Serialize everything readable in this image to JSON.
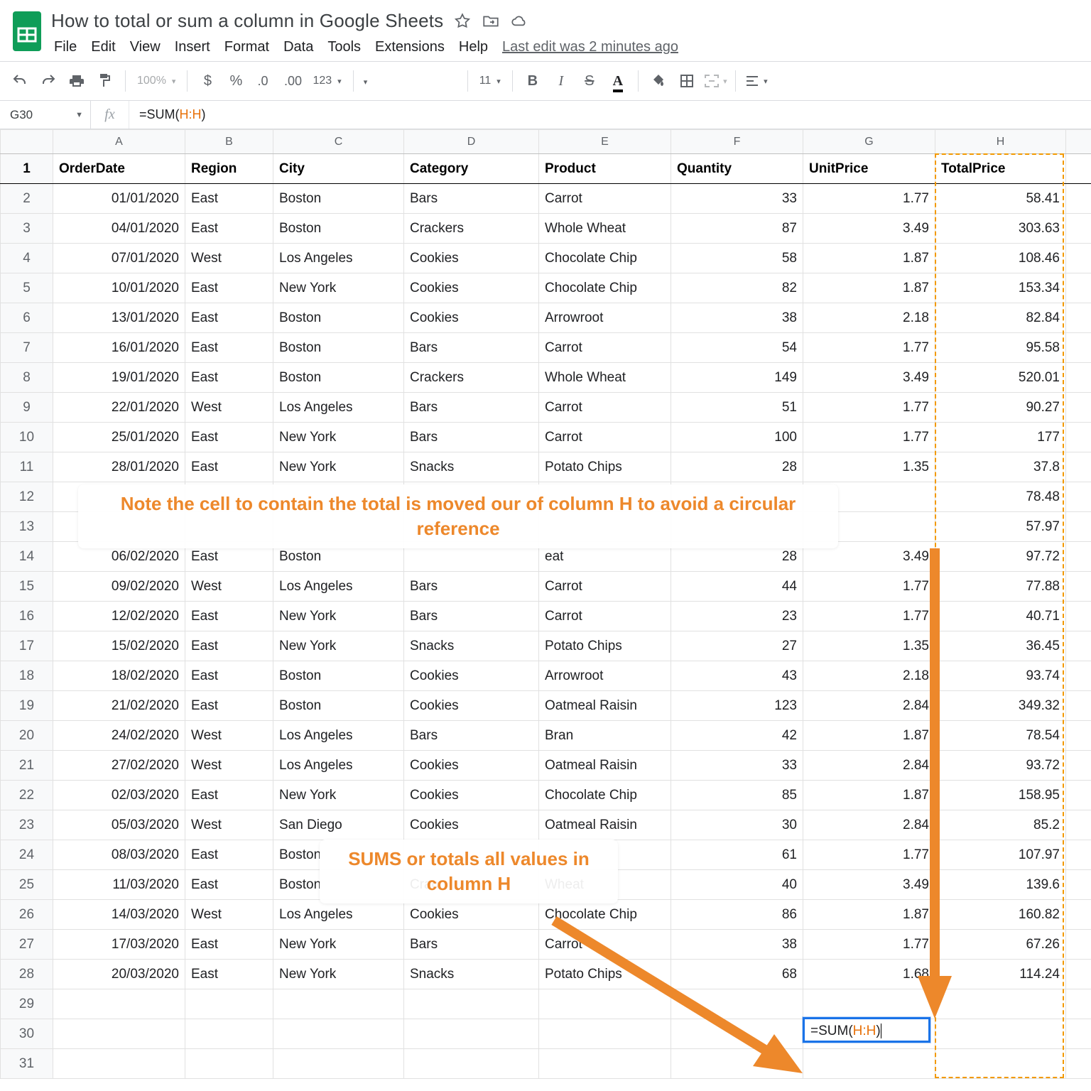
{
  "doc": {
    "title": "How to total or sum a column in Google Sheets",
    "last_edit": "Last edit was 2 minutes ago"
  },
  "menu": [
    "File",
    "Edit",
    "View",
    "Insert",
    "Format",
    "Data",
    "Tools",
    "Extensions",
    "Help"
  ],
  "toolbar": {
    "zoom": "100%",
    "number_format": "123",
    "font_size": "11"
  },
  "formula_bar": {
    "cell": "G30",
    "prefix": "=SUM(",
    "ref": "H:H",
    "suffix": ")"
  },
  "columns": [
    "A",
    "B",
    "C",
    "D",
    "E",
    "F",
    "G",
    "H"
  ],
  "headers": {
    "A": "OrderDate",
    "B": "Region",
    "C": "City",
    "D": "Category",
    "E": "Product",
    "F": "Quantity",
    "G": "UnitPrice",
    "H": "TotalPrice"
  },
  "rows": [
    {
      "n": 2,
      "A": "01/01/2020",
      "B": "East",
      "C": "Boston",
      "D": "Bars",
      "E": "Carrot",
      "F": "33",
      "G": "1.77",
      "H": "58.41"
    },
    {
      "n": 3,
      "A": "04/01/2020",
      "B": "East",
      "C": "Boston",
      "D": "Crackers",
      "E": "Whole Wheat",
      "F": "87",
      "G": "3.49",
      "H": "303.63"
    },
    {
      "n": 4,
      "A": "07/01/2020",
      "B": "West",
      "C": "Los Angeles",
      "D": "Cookies",
      "E": "Chocolate Chip",
      "F": "58",
      "G": "1.87",
      "H": "108.46"
    },
    {
      "n": 5,
      "A": "10/01/2020",
      "B": "East",
      "C": "New York",
      "D": "Cookies",
      "E": "Chocolate Chip",
      "F": "82",
      "G": "1.87",
      "H": "153.34"
    },
    {
      "n": 6,
      "A": "13/01/2020",
      "B": "East",
      "C": "Boston",
      "D": "Cookies",
      "E": "Arrowroot",
      "F": "38",
      "G": "2.18",
      "H": "82.84"
    },
    {
      "n": 7,
      "A": "16/01/2020",
      "B": "East",
      "C": "Boston",
      "D": "Bars",
      "E": "Carrot",
      "F": "54",
      "G": "1.77",
      "H": "95.58"
    },
    {
      "n": 8,
      "A": "19/01/2020",
      "B": "East",
      "C": "Boston",
      "D": "Crackers",
      "E": "Whole Wheat",
      "F": "149",
      "G": "3.49",
      "H": "520.01"
    },
    {
      "n": 9,
      "A": "22/01/2020",
      "B": "West",
      "C": "Los Angeles",
      "D": "Bars",
      "E": "Carrot",
      "F": "51",
      "G": "1.77",
      "H": "90.27"
    },
    {
      "n": 10,
      "A": "25/01/2020",
      "B": "East",
      "C": "New York",
      "D": "Bars",
      "E": "Carrot",
      "F": "100",
      "G": "1.77",
      "H": "177"
    },
    {
      "n": 11,
      "A": "28/01/2020",
      "B": "East",
      "C": "New York",
      "D": "Snacks",
      "E": "Potato Chips",
      "F": "28",
      "G": "1.35",
      "H": "37.8"
    },
    {
      "n": 12,
      "A": "",
      "B": "",
      "C": "",
      "D": "",
      "E": "",
      "F": "",
      "G": "",
      "H": "78.48"
    },
    {
      "n": 13,
      "A": "",
      "B": "",
      "C": "",
      "D": "",
      "E": "",
      "F": "",
      "G": "",
      "H": "57.97"
    },
    {
      "n": 14,
      "A": "06/02/2020",
      "B": "East",
      "C": "Boston",
      "D": "",
      "E": "eat",
      "F": "28",
      "G": "3.49",
      "H": "97.72"
    },
    {
      "n": 15,
      "A": "09/02/2020",
      "B": "West",
      "C": "Los Angeles",
      "D": "Bars",
      "E": "Carrot",
      "F": "44",
      "G": "1.77",
      "H": "77.88"
    },
    {
      "n": 16,
      "A": "12/02/2020",
      "B": "East",
      "C": "New York",
      "D": "Bars",
      "E": "Carrot",
      "F": "23",
      "G": "1.77",
      "H": "40.71"
    },
    {
      "n": 17,
      "A": "15/02/2020",
      "B": "East",
      "C": "New York",
      "D": "Snacks",
      "E": "Potato Chips",
      "F": "27",
      "G": "1.35",
      "H": "36.45"
    },
    {
      "n": 18,
      "A": "18/02/2020",
      "B": "East",
      "C": "Boston",
      "D": "Cookies",
      "E": "Arrowroot",
      "F": "43",
      "G": "2.18",
      "H": "93.74"
    },
    {
      "n": 19,
      "A": "21/02/2020",
      "B": "East",
      "C": "Boston",
      "D": "Cookies",
      "E": "Oatmeal Raisin",
      "F": "123",
      "G": "2.84",
      "H": "349.32"
    },
    {
      "n": 20,
      "A": "24/02/2020",
      "B": "West",
      "C": "Los Angeles",
      "D": "Bars",
      "E": "Bran",
      "F": "42",
      "G": "1.87",
      "H": "78.54"
    },
    {
      "n": 21,
      "A": "27/02/2020",
      "B": "West",
      "C": "Los Angeles",
      "D": "Cookies",
      "E": "Oatmeal Raisin",
      "F": "33",
      "G": "2.84",
      "H": "93.72"
    },
    {
      "n": 22,
      "A": "02/03/2020",
      "B": "East",
      "C": "New York",
      "D": "Cookies",
      "E": "Chocolate Chip",
      "F": "85",
      "G": "1.87",
      "H": "158.95"
    },
    {
      "n": 23,
      "A": "05/03/2020",
      "B": "West",
      "C": "San Diego",
      "D": "Cookies",
      "E": "Oatmeal Raisin",
      "F": "30",
      "G": "2.84",
      "H": "85.2"
    },
    {
      "n": 24,
      "A": "08/03/2020",
      "B": "East",
      "C": "Boston",
      "D": "",
      "E": "",
      "F": "61",
      "G": "1.77",
      "H": "107.97"
    },
    {
      "n": 25,
      "A": "11/03/2020",
      "B": "East",
      "C": "Boston",
      "D": "Crac",
      "E": "Wheat",
      "F": "40",
      "G": "3.49",
      "H": "139.6"
    },
    {
      "n": 26,
      "A": "14/03/2020",
      "B": "West",
      "C": "Los Angeles",
      "D": "Cookies",
      "E": "Chocolate Chip",
      "F": "86",
      "G": "1.87",
      "H": "160.82"
    },
    {
      "n": 27,
      "A": "17/03/2020",
      "B": "East",
      "C": "New York",
      "D": "Bars",
      "E": "Carrot",
      "F": "38",
      "G": "1.77",
      "H": "67.26"
    },
    {
      "n": 28,
      "A": "20/03/2020",
      "B": "East",
      "C": "New York",
      "D": "Snacks",
      "E": "Potato Chips",
      "F": "68",
      "G": "1.68",
      "H": "114.24"
    }
  ],
  "empty_rows": [
    29,
    30,
    31
  ],
  "active_cell": {
    "display_prefix": "=SUM(",
    "display_ref": "H:H",
    "display_suffix": ")"
  },
  "annotations": {
    "top": "Note the cell to contain the total is moved our of column H to avoid a circular reference",
    "mid": "SUMS or totals all values in column H"
  }
}
